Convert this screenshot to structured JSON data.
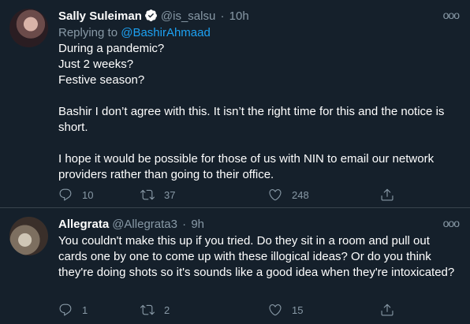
{
  "tweets": [
    {
      "name": "Sally Suleiman",
      "handle": "@is_salsu",
      "sep": "·",
      "time": "10h",
      "replying_prefix": "Replying to",
      "replying_to": "@BashirAhmaad",
      "lines": [
        "During a pandemic?",
        "Just 2 weeks?",
        "Festive season?",
        "",
        "Bashir I don’t agree with this. It isn’t the right time for this and the notice is short.",
        "",
        "I hope it would be possible for those of us with NIN to email our network providers rather than going to their office."
      ],
      "replies": "10",
      "retweets": "37",
      "likes": "248",
      "verified": true
    },
    {
      "name": "Allegrata",
      "handle": "@Allegrata3",
      "sep": "·",
      "time": "9h",
      "lines": [
        "You couldn't make this up if you tried. Do they sit in a room and pull out cards one by one to come up with these illogical ideas? Or do you think they're doing shots so it's sounds like a good idea when they're intoxicated?"
      ],
      "replies": "1",
      "retweets": "2",
      "likes": "15",
      "verified": false
    }
  ],
  "more_glyph": "ooo",
  "colors": {
    "background": "#15202b",
    "text": "#ffffff",
    "secondary": "#8899a6",
    "accent": "#1da1f2",
    "divider": "#38444d"
  },
  "icons": [
    "verified-badge-icon",
    "reply-icon",
    "retweet-icon",
    "like-icon",
    "share-icon",
    "more-icon"
  ]
}
